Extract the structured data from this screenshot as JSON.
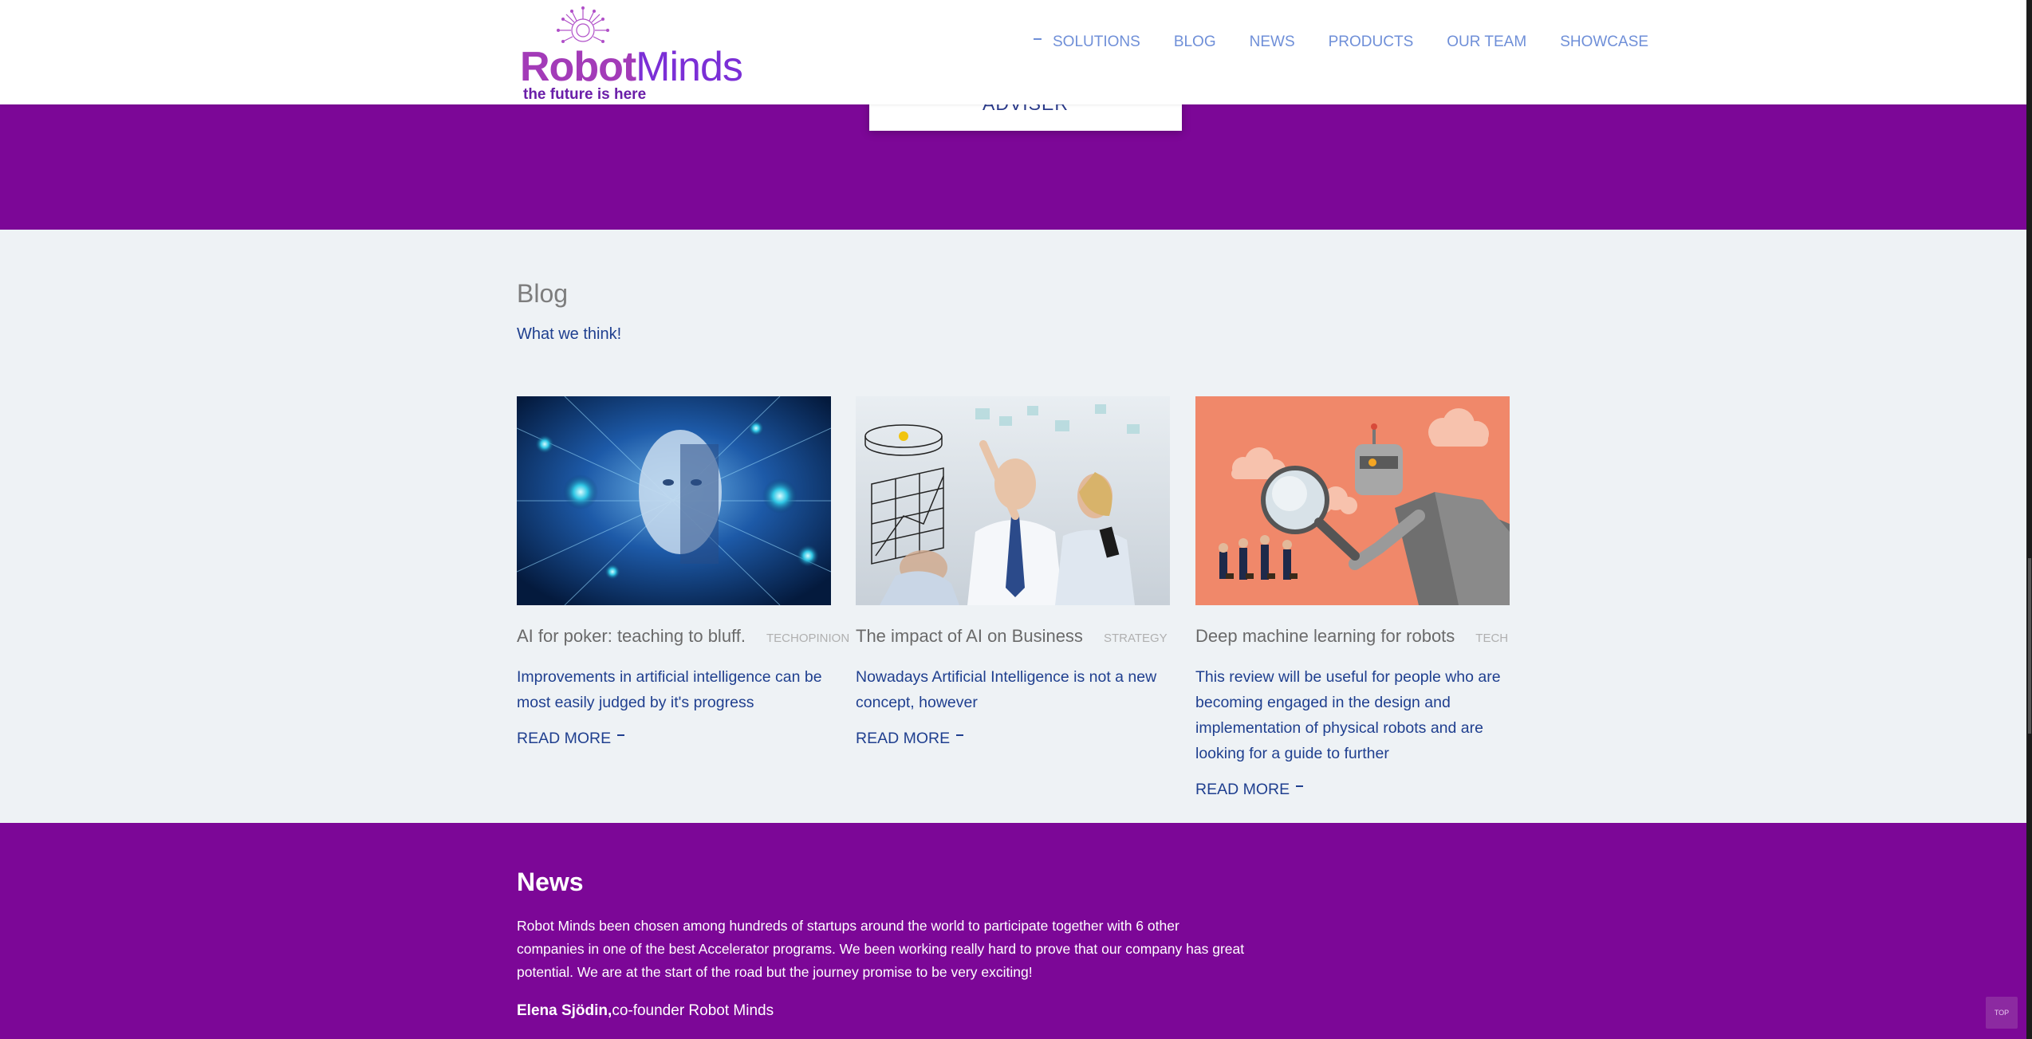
{
  "header": {
    "logo": {
      "brand_part1": "Robot",
      "brand_part2": "Minds",
      "tagline": "the future is here"
    },
    "nav": [
      {
        "label": "SOLUTIONS",
        "active": true
      },
      {
        "label": "BLOG"
      },
      {
        "label": "NEWS"
      },
      {
        "label": "PRODUCTS"
      },
      {
        "label": "OUR TEAM"
      },
      {
        "label": "SHOWCASE"
      }
    ]
  },
  "hero": {
    "button_label": "ADVISER"
  },
  "blog": {
    "title": "Blog",
    "subtitle": "What we think!",
    "posts": [
      {
        "title": "AI for poker: teaching to bluff.",
        "tag": "TECHOPINION",
        "excerpt": "Improvements in artificial intelligence can be most easily judged by it's progress",
        "read_more": "READ MORE",
        "image": "ai-face-circuit-image"
      },
      {
        "title": "The impact of AI on Business",
        "tag": "STRATEGY",
        "excerpt": "Nowadays Artificial Intelligence is not a new concept, however",
        "read_more": "READ MORE",
        "image": "business-team-chart-image"
      },
      {
        "title": "Deep machine learning for robots",
        "tag": "TECH",
        "excerpt": "This review will be useful for people who are becoming engaged in the design and implementation of physical robots and are looking for a guide to further",
        "read_more": "READ MORE",
        "image": "robot-magnifier-image"
      }
    ]
  },
  "news": {
    "title": "News",
    "body": "Robot Minds been chosen among hundreds of startups around the world to participate together with 6 other companies in one of the best Accelerator programs. We been working really hard to prove that our company has great potential. We are at the start of the road but the journey promise to be very exciting!",
    "author": "Elena Sjödin,",
    "author_role": "co-founder Robot Minds"
  },
  "top_button": "TOP",
  "colors": {
    "brand_purple": "#7c0797",
    "link_blue": "#1f3f8f",
    "nav_blue": "#6f8fd8"
  }
}
